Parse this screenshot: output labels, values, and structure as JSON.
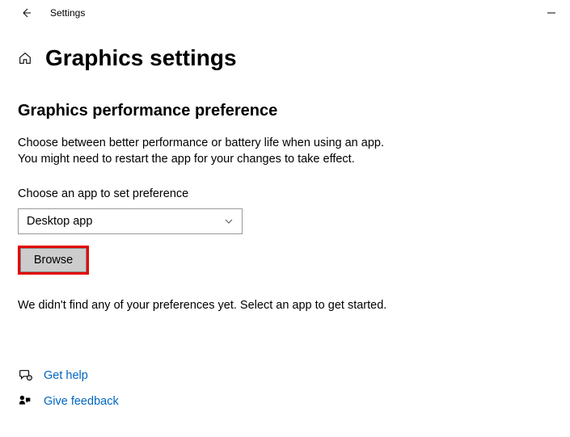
{
  "titlebar": {
    "title": "Settings"
  },
  "page": {
    "title": "Graphics settings"
  },
  "section": {
    "heading": "Graphics performance preference",
    "description_line1": "Choose between better performance or battery life when using an app.",
    "description_line2": "You might need to restart the app for your changes to take effect.",
    "dropdown_label": "Choose an app to set preference",
    "dropdown_value": "Desktop app",
    "browse_label": "Browse",
    "status_text": "We didn't find any of your preferences yet. Select an app to get started."
  },
  "links": {
    "help": "Get help",
    "feedback": "Give feedback"
  }
}
